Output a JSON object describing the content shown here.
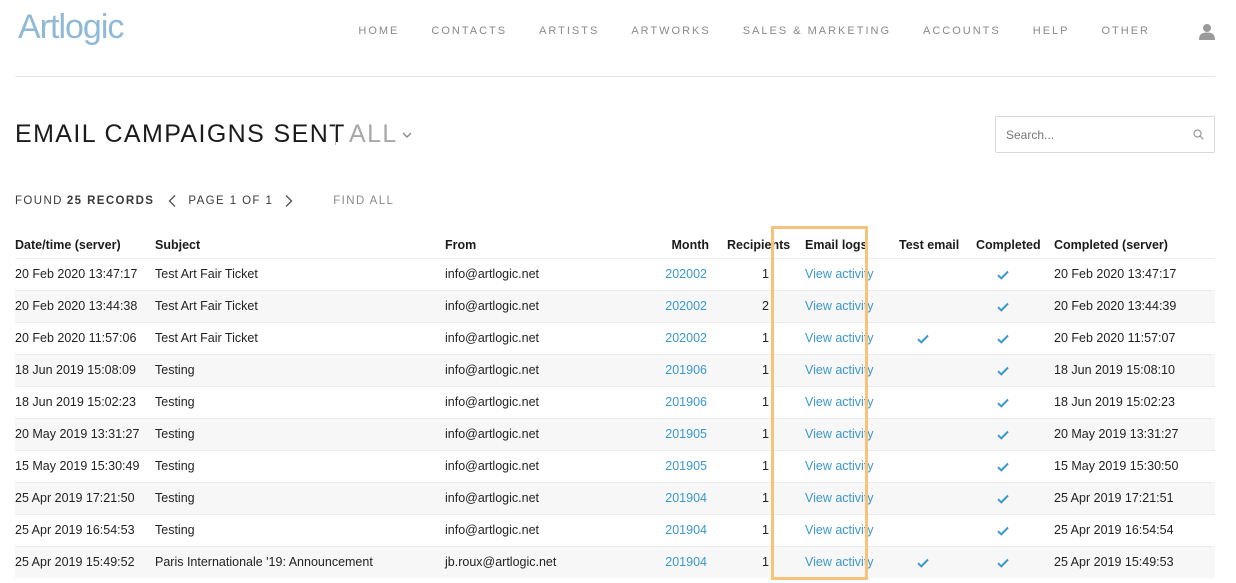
{
  "app": {
    "logo": "Artlogic"
  },
  "nav": {
    "items": [
      {
        "label": "HOME"
      },
      {
        "label": "CONTACTS"
      },
      {
        "label": "ARTISTS"
      },
      {
        "label": "ARTWORKS"
      },
      {
        "label": "SALES & MARKETING"
      },
      {
        "label": "ACCOUNTS"
      },
      {
        "label": "HELP"
      },
      {
        "label": "OTHER"
      }
    ],
    "user_icon": "user-icon"
  },
  "page": {
    "title": "EMAIL CAMPAIGNS SENT",
    "filter": "ALL",
    "filter_icon": "chevron-down-icon"
  },
  "search": {
    "placeholder": "Search...",
    "value": "",
    "icon": "search-icon"
  },
  "records": {
    "found_label": "FOUND",
    "count_label": "25 RECORDS",
    "page_label": "PAGE 1 OF 1",
    "find_all_label": "FIND ALL"
  },
  "table": {
    "columns": [
      "Date/time (server)",
      "Subject",
      "From",
      "Month",
      "Recipients",
      "Email logs",
      "Test email",
      "Completed",
      "Completed (server)"
    ],
    "rows": [
      {
        "datetime": "20 Feb 2020 13:47:17",
        "subject": "Test Art Fair Ticket",
        "from": "info@artlogic.net",
        "month": "202002",
        "recipients": "1",
        "logs": "View activity",
        "test": false,
        "completed": true,
        "completed_server": "20 Feb 2020 13:47:17"
      },
      {
        "datetime": "20 Feb 2020 13:44:38",
        "subject": "Test Art Fair Ticket",
        "from": "info@artlogic.net",
        "month": "202002",
        "recipients": "2",
        "logs": "View activity",
        "test": false,
        "completed": true,
        "completed_server": "20 Feb 2020 13:44:39"
      },
      {
        "datetime": "20 Feb 2020 11:57:06",
        "subject": "Test Art Fair Ticket",
        "from": "info@artlogic.net",
        "month": "202002",
        "recipients": "1",
        "logs": "View activity",
        "test": true,
        "completed": true,
        "completed_server": "20 Feb 2020 11:57:07"
      },
      {
        "datetime": "18 Jun 2019 15:08:09",
        "subject": "Testing",
        "from": "info@artlogic.net",
        "month": "201906",
        "recipients": "1",
        "logs": "View activity",
        "test": false,
        "completed": true,
        "completed_server": "18 Jun 2019 15:08:10"
      },
      {
        "datetime": "18 Jun 2019 15:02:23",
        "subject": "Testing",
        "from": "info@artlogic.net",
        "month": "201906",
        "recipients": "1",
        "logs": "View activity",
        "test": false,
        "completed": true,
        "completed_server": "18 Jun 2019 15:02:23"
      },
      {
        "datetime": "20 May 2019 13:31:27",
        "subject": "Testing",
        "from": "info@artlogic.net",
        "month": "201905",
        "recipients": "1",
        "logs": "View activity",
        "test": false,
        "completed": true,
        "completed_server": "20 May 2019 13:31:27"
      },
      {
        "datetime": "15 May 2019 15:30:49",
        "subject": "Testing",
        "from": "info@artlogic.net",
        "month": "201905",
        "recipients": "1",
        "logs": "View activity",
        "test": false,
        "completed": true,
        "completed_server": "15 May 2019 15:30:50"
      },
      {
        "datetime": "25 Apr 2019 17:21:50",
        "subject": "Testing",
        "from": "info@artlogic.net",
        "month": "201904",
        "recipients": "1",
        "logs": "View activity",
        "test": false,
        "completed": true,
        "completed_server": "25 Apr 2019 17:21:51"
      },
      {
        "datetime": "25 Apr 2019 16:54:53",
        "subject": "Testing",
        "from": "info@artlogic.net",
        "month": "201904",
        "recipients": "1",
        "logs": "View activity",
        "test": false,
        "completed": true,
        "completed_server": "25 Apr 2019 16:54:54"
      },
      {
        "datetime": "25 Apr 2019 15:49:52",
        "subject": "Paris Internationale '19: Announcement",
        "from": "jb.roux@artlogic.net",
        "month": "201904",
        "recipients": "1",
        "logs": "View activity",
        "test": true,
        "completed": true,
        "completed_server": "25 Apr 2019 15:49:53"
      }
    ]
  },
  "colors": {
    "accent": "#3a98cf",
    "logo": "#8fb9d6",
    "highlight": "#f7c27a",
    "check": "#3a98cf"
  },
  "icons": {
    "check": "check-icon",
    "prev": "chevron-left-icon",
    "next": "chevron-right-icon"
  }
}
